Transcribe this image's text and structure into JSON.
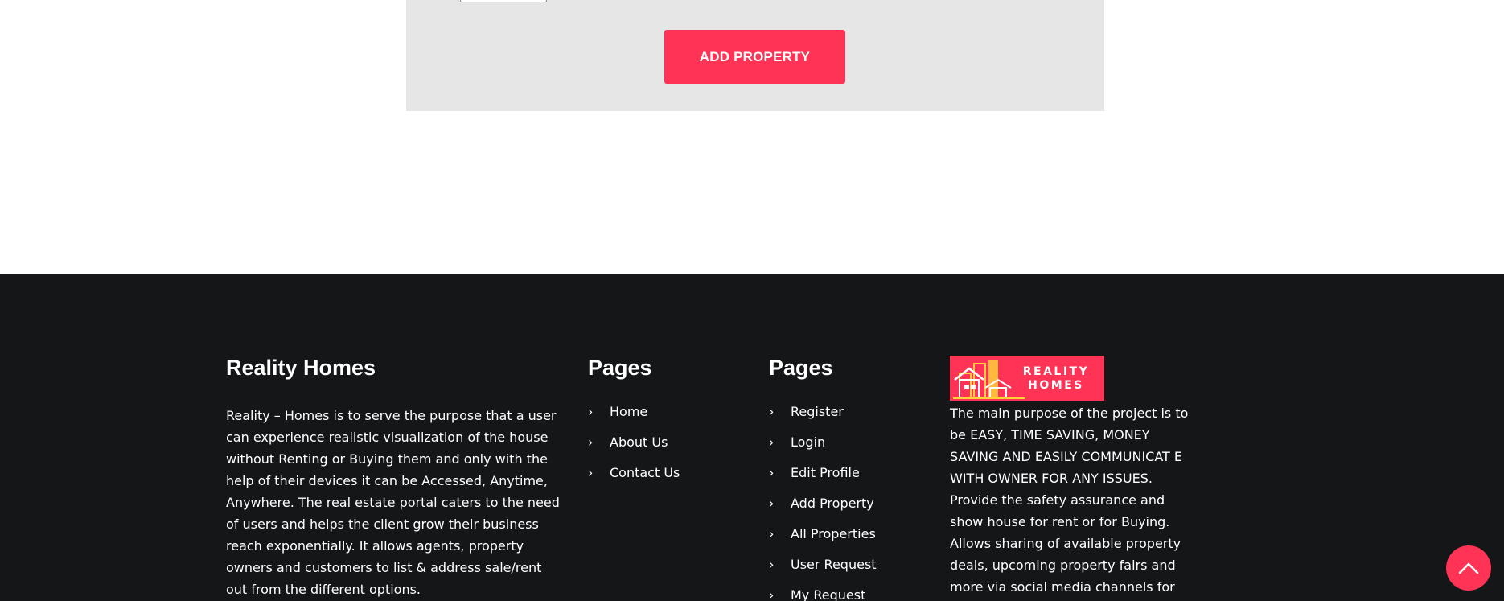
{
  "form": {
    "submit_label": "ADD PROPERTY"
  },
  "footer": {
    "about": {
      "title": "Reality Homes",
      "text": "Reality – Homes is to serve the purpose that a user can experience realistic visualization of the house without Renting or Buying them and only with the help of their devices it can be Accessed, Anytime, Anywhere. The real estate portal caters to the need of users and helps the client grow their business reach exponentially. It allows agents, property owners and customers to list & address sale/rent out from the different options."
    },
    "pages_a": {
      "title": "Pages",
      "links": [
        "Home",
        "About Us",
        "Contact Us"
      ]
    },
    "pages_b": {
      "title": "Pages",
      "links": [
        "Register",
        "Login",
        "Edit Profile",
        "Add Property",
        "All Properties",
        "User Request",
        "My Request"
      ]
    },
    "brand": {
      "logo_line1": "REALITY",
      "logo_line2": "HOMES",
      "description": "The main purpose of the project is to be EASY, TIME SAVING, MONEY SAVING AND EASILY COMMUNICAT E WITH OWNER FOR ANY ISSUES. Provide the safety assurance and show house for rent or for Buying. Allows sharing of available property deals, upcoming property fairs and more via social media channels for the"
    }
  },
  "icons": {
    "link_chevron": "chevron-right-icon",
    "scroll_top": "chevron-up-icon",
    "logo_art": "house-building-icon"
  },
  "colors": {
    "accent": "#ff3355",
    "footer_bg": "#141618",
    "form_bg": "#e6e6e6"
  }
}
